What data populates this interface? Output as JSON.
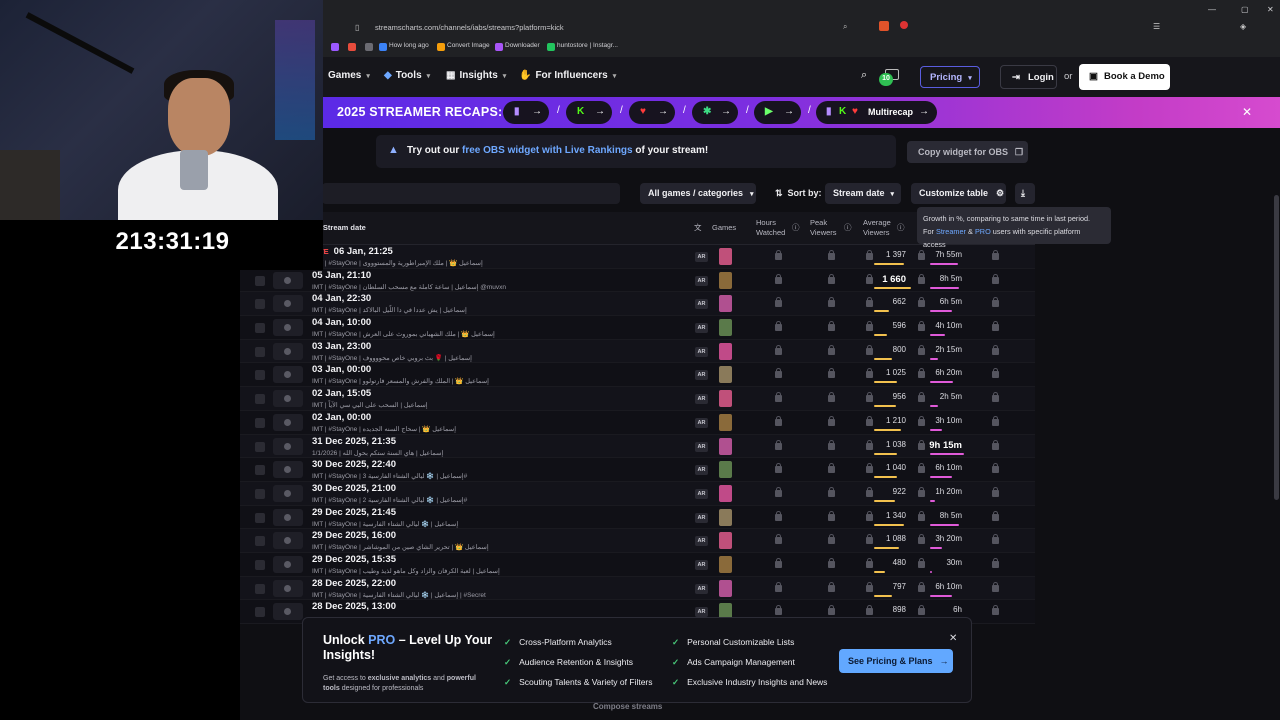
{
  "overlay": {
    "timer": "213:31:19"
  },
  "browser": {
    "url": "streamscharts.com/channels/iabs/streams?platform=kick",
    "bookmarks": [
      "How long ago",
      "Convert Image",
      "Downloader",
      "huntostore | Instagr..."
    ]
  },
  "nav": {
    "items": [
      "Games",
      "Tools",
      "Insights",
      "For Influencers"
    ],
    "notif_count": "10",
    "pricing": "Pricing",
    "login": "Login",
    "or": "or",
    "demo": "Book a Demo"
  },
  "recap": {
    "title": "2025 STREAMER RECAPS:",
    "multi": "Multirecap"
  },
  "obs": {
    "prefix": "Try out our",
    "link": "free OBS widget with Live Rankings",
    "suffix": "of your stream!",
    "button": "Copy widget for OBS"
  },
  "filters": {
    "games": "All games / categories",
    "sort_label": "Sort by:",
    "sort_value": "Stream date",
    "customize": "Customize table"
  },
  "tooltip": {
    "line1": "Growth in %, comparing to same time in last period.",
    "line2_a": "For",
    "line2_b": "Streamer",
    "line2_c": "&",
    "line2_d": "PRO",
    "line2_e": "users with specific platform access"
  },
  "table": {
    "headers": {
      "stream_date": "Stream date",
      "games": "Games",
      "hours": "Hours\nWatched",
      "peak": "Peak\nViewers",
      "avg": "Average\nViewers"
    },
    "live_label": "LIVE",
    "rows": [
      {
        "date": "06 Jan, 21:25",
        "title": "IMT | #StayOne | إسماعيل 👑 | ملك الإمبراطورية والمستوووى",
        "lang": "AR",
        "avg": "1 397",
        "avg_pct": 0.5,
        "dur": "7h 55m",
        "dur_pct": 0.7,
        "live": true
      },
      {
        "date": "05 Jan, 21:10",
        "title": "IMT | #StayOne | إسماعيل | ساعة كاملة مع مسحب السلطان @muvxn",
        "lang": "AR",
        "avg": "1 660",
        "avg_pct": 0.62,
        "dur": "8h 5m",
        "dur_pct": 0.72,
        "big_avg": true
      },
      {
        "date": "04 Jan, 22:30",
        "title": "IMT | #StayOne | إسماعيل | يش عددا في دا اللّيل البالاكد",
        "lang": "AR",
        "avg": "662",
        "avg_pct": 0.25,
        "dur": "6h 5m",
        "dur_pct": 0.55
      },
      {
        "date": "04 Jan, 10:00",
        "title": "IMT | #StayOne | إسماعيل 👑 | ملك الشهباني بموروث على العرش",
        "lang": "AR",
        "avg": "596",
        "avg_pct": 0.22,
        "dur": "4h 10m",
        "dur_pct": 0.38
      },
      {
        "date": "03 Jan, 23:00",
        "title": "IMT | #StayOne | إسماعيل | 🌹 بث بروبي خاص محووووف",
        "lang": "AR",
        "avg": "800",
        "avg_pct": 0.3,
        "dur": "2h 15m",
        "dur_pct": 0.2
      },
      {
        "date": "03 Jan, 00:00",
        "title": "IMT | #StayOne | إسماعيل 👑 | الملك والفرش والمسعر فارتولوو",
        "lang": "AR",
        "avg": "1 025",
        "avg_pct": 0.38,
        "dur": "6h 20m",
        "dur_pct": 0.58
      },
      {
        "date": "02 Jan, 15:05",
        "title": "IMT | إسماعيل | السحب على البي سي الآياً",
        "lang": "AR",
        "avg": "956",
        "avg_pct": 0.36,
        "dur": "2h 5m",
        "dur_pct": 0.19
      },
      {
        "date": "02 Jan, 00:00",
        "title": "IMT | #StayOne | إسماعيل 👑 | سحاج السنه الجديده",
        "lang": "AR",
        "avg": "1 210",
        "avg_pct": 0.45,
        "dur": "3h 10m",
        "dur_pct": 0.29
      },
      {
        "date": "31 Dec 2025, 21:35",
        "title": "1/1/2026 | إسماعيل | هاي السنة ستكم بحول الله",
        "lang": "AR",
        "avg": "1 038",
        "avg_pct": 0.39,
        "dur": "9h 15m",
        "dur_pct": 0.85,
        "big_dur": true
      },
      {
        "date": "30 Dec 2025, 22:40",
        "title": "IMT | #StayOne | إسماعيل | ❄️ ليالي الشتاء الفارسية 3#",
        "lang": "AR",
        "avg": "1 040",
        "avg_pct": 0.39,
        "dur": "6h 10m",
        "dur_pct": 0.56
      },
      {
        "date": "30 Dec 2025, 21:00",
        "title": "IMT | #StayOne | إسماعيل | ❄️ ليالي الشتاء الفارسية 2#",
        "lang": "AR",
        "avg": "922",
        "avg_pct": 0.35,
        "dur": "1h 20m",
        "dur_pct": 0.12
      },
      {
        "date": "29 Dec 2025, 21:45",
        "title": "IMT | #StayOne | إسماعيل | ❄️ ليالي الشتاء الفارسية",
        "lang": "AR",
        "avg": "1 340",
        "avg_pct": 0.5,
        "dur": "8h 5m",
        "dur_pct": 0.72
      },
      {
        "date": "29 Dec 2025, 16:00",
        "title": "IMT | #StayOne | إسماعيل 👑 | تحرير الشاي صين من الموشاشر",
        "lang": "AR",
        "avg": "1 088",
        "avg_pct": 0.41,
        "dur": "3h 20m",
        "dur_pct": 0.3
      },
      {
        "date": "29 Dec 2025, 15:35",
        "title": "IMT | #StayOne | إسماعيل | لعبة الكرفان والزاد وكل ماهو لذيذ وطيب",
        "lang": "AR",
        "avg": "480",
        "avg_pct": 0.18,
        "dur": "30m",
        "dur_pct": 0.05
      },
      {
        "date": "28 Dec 2025, 22:00",
        "title": "IMT | #StayOne | إسماعيل | ❄️ ليالي الشتاء الفارسية | #Secret",
        "lang": "AR",
        "avg": "797",
        "avg_pct": 0.3,
        "dur": "6h 10m",
        "dur_pct": 0.56
      },
      {
        "date": "28 Dec 2025, 13:00",
        "title": "",
        "lang": "AR",
        "avg": "898",
        "avg_pct": 0.34,
        "dur": "6h",
        "dur_pct": 0.54
      }
    ]
  },
  "promo": {
    "title_a": "Unlock",
    "title_pro": "PRO",
    "title_b": "– Level Up Your Insights!",
    "sub_a": "Get access to",
    "sub_b": "exclusive analytics",
    "sub_c": "and",
    "sub_d": "powerful tools",
    "sub_e": "designed for professionals",
    "features_col1": [
      "Cross-Platform Analytics",
      "Audience Retention & Insights",
      "Scouting Talents & Variety of Filters"
    ],
    "features_col2": [
      "Personal Customizable Lists",
      "Ads Campaign Management",
      "Exclusive Industry Insights and News"
    ],
    "cta": "See Pricing & Plans"
  },
  "compose": "Compose streams",
  "colors": {
    "accent": "#62a8ff",
    "banner_start": "#5b2ae6",
    "banner_end": "#d64bcf",
    "live": "#ff4a4a"
  }
}
